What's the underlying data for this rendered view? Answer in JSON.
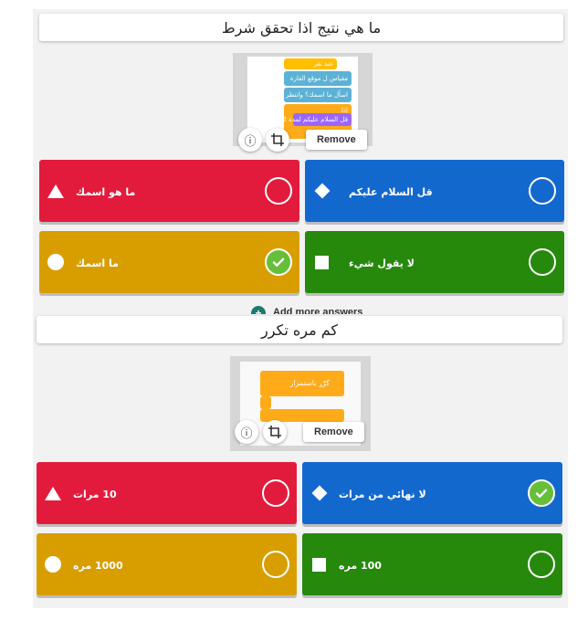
{
  "questions": [
    {
      "title": "ما هي نتيج  اذا تحقق شرط",
      "media": {
        "remove_label": "Remove",
        "info_icon": "info-icon",
        "crop_icon": "crop-icon",
        "blocks": [
          "عند نقر",
          "مقياس ل   موقع الفارة",
          "اسأل   ما اسمك؟   وانتظر",
          "إذا",
          "قل   السلام عليكم   لمدة  2  ثانية"
        ],
        "block_value": "2"
      },
      "answers": [
        {
          "label": "ما  هو اسمك",
          "shape": "triangle",
          "color": "#e21b3c",
          "correct": false
        },
        {
          "label": "قل السلام عليكم",
          "shape": "diamond",
          "color": "#1368ce",
          "correct": false
        },
        {
          "label": "ما اسمك",
          "shape": "circle",
          "color": "#d89e00",
          "correct": true
        },
        {
          "label": "لا يقول شيء",
          "shape": "square",
          "color": "#26890c",
          "correct": false
        }
      ]
    },
    {
      "title": "كم  مره تكرر",
      "media": {
        "remove_label": "Remove",
        "info_icon": "info-icon",
        "crop_icon": "crop-icon",
        "blocks": [
          "كرّر باستمرار"
        ]
      },
      "answers": [
        {
          "label": "10 مرات",
          "shape": "triangle",
          "color": "#e21b3c",
          "correct": false
        },
        {
          "label": "لا نهائي من مرات",
          "shape": "diamond",
          "color": "#1368ce",
          "correct": true
        },
        {
          "label": "1000 مره",
          "shape": "circle",
          "color": "#d89e00",
          "correct": false
        },
        {
          "label": "100 مره",
          "shape": "square",
          "color": "#26890c",
          "correct": false
        }
      ]
    }
  ],
  "add_more_label": "Add more answers"
}
